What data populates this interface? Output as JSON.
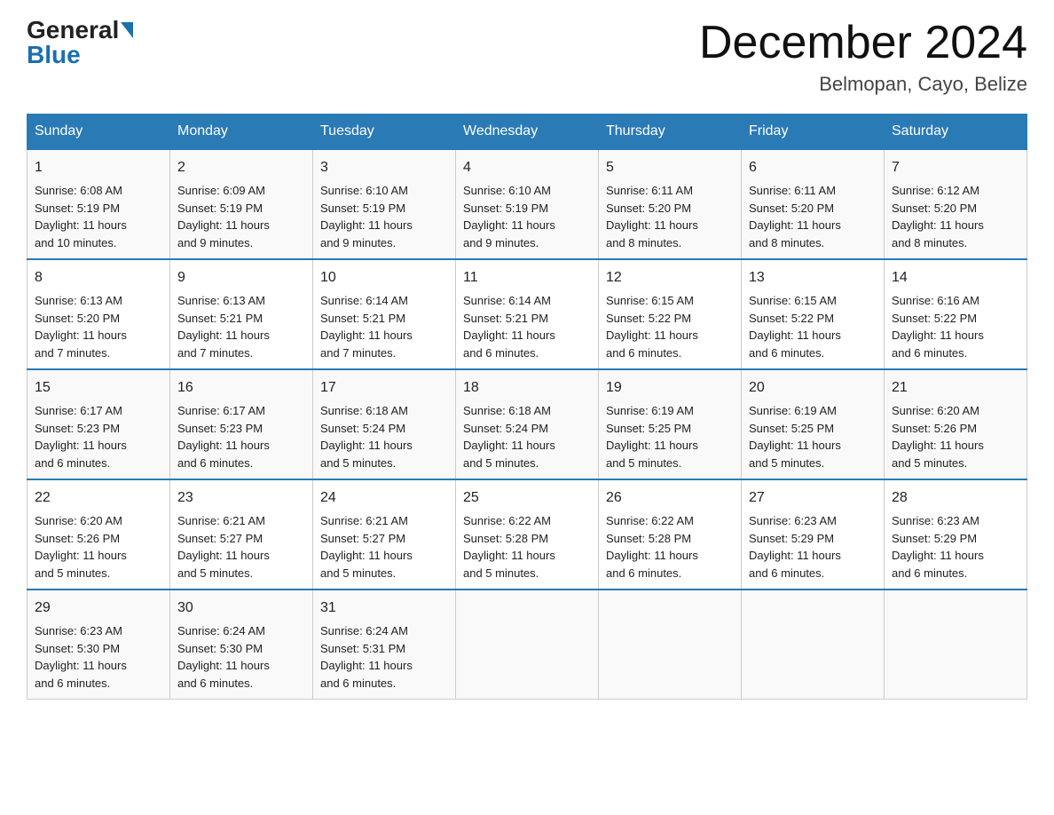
{
  "logo": {
    "general": "General",
    "blue": "Blue"
  },
  "title": "December 2024",
  "subtitle": "Belmopan, Cayo, Belize",
  "weekdays": [
    "Sunday",
    "Monday",
    "Tuesday",
    "Wednesday",
    "Thursday",
    "Friday",
    "Saturday"
  ],
  "weeks": [
    [
      {
        "day": "1",
        "sunrise": "6:08 AM",
        "sunset": "5:19 PM",
        "daylight": "11 hours and 10 minutes."
      },
      {
        "day": "2",
        "sunrise": "6:09 AM",
        "sunset": "5:19 PM",
        "daylight": "11 hours and 9 minutes."
      },
      {
        "day": "3",
        "sunrise": "6:10 AM",
        "sunset": "5:19 PM",
        "daylight": "11 hours and 9 minutes."
      },
      {
        "day": "4",
        "sunrise": "6:10 AM",
        "sunset": "5:19 PM",
        "daylight": "11 hours and 9 minutes."
      },
      {
        "day": "5",
        "sunrise": "6:11 AM",
        "sunset": "5:20 PM",
        "daylight": "11 hours and 8 minutes."
      },
      {
        "day": "6",
        "sunrise": "6:11 AM",
        "sunset": "5:20 PM",
        "daylight": "11 hours and 8 minutes."
      },
      {
        "day": "7",
        "sunrise": "6:12 AM",
        "sunset": "5:20 PM",
        "daylight": "11 hours and 8 minutes."
      }
    ],
    [
      {
        "day": "8",
        "sunrise": "6:13 AM",
        "sunset": "5:20 PM",
        "daylight": "11 hours and 7 minutes."
      },
      {
        "day": "9",
        "sunrise": "6:13 AM",
        "sunset": "5:21 PM",
        "daylight": "11 hours and 7 minutes."
      },
      {
        "day": "10",
        "sunrise": "6:14 AM",
        "sunset": "5:21 PM",
        "daylight": "11 hours and 7 minutes."
      },
      {
        "day": "11",
        "sunrise": "6:14 AM",
        "sunset": "5:21 PM",
        "daylight": "11 hours and 6 minutes."
      },
      {
        "day": "12",
        "sunrise": "6:15 AM",
        "sunset": "5:22 PM",
        "daylight": "11 hours and 6 minutes."
      },
      {
        "day": "13",
        "sunrise": "6:15 AM",
        "sunset": "5:22 PM",
        "daylight": "11 hours and 6 minutes."
      },
      {
        "day": "14",
        "sunrise": "6:16 AM",
        "sunset": "5:22 PM",
        "daylight": "11 hours and 6 minutes."
      }
    ],
    [
      {
        "day": "15",
        "sunrise": "6:17 AM",
        "sunset": "5:23 PM",
        "daylight": "11 hours and 6 minutes."
      },
      {
        "day": "16",
        "sunrise": "6:17 AM",
        "sunset": "5:23 PM",
        "daylight": "11 hours and 6 minutes."
      },
      {
        "day": "17",
        "sunrise": "6:18 AM",
        "sunset": "5:24 PM",
        "daylight": "11 hours and 5 minutes."
      },
      {
        "day": "18",
        "sunrise": "6:18 AM",
        "sunset": "5:24 PM",
        "daylight": "11 hours and 5 minutes."
      },
      {
        "day": "19",
        "sunrise": "6:19 AM",
        "sunset": "5:25 PM",
        "daylight": "11 hours and 5 minutes."
      },
      {
        "day": "20",
        "sunrise": "6:19 AM",
        "sunset": "5:25 PM",
        "daylight": "11 hours and 5 minutes."
      },
      {
        "day": "21",
        "sunrise": "6:20 AM",
        "sunset": "5:26 PM",
        "daylight": "11 hours and 5 minutes."
      }
    ],
    [
      {
        "day": "22",
        "sunrise": "6:20 AM",
        "sunset": "5:26 PM",
        "daylight": "11 hours and 5 minutes."
      },
      {
        "day": "23",
        "sunrise": "6:21 AM",
        "sunset": "5:27 PM",
        "daylight": "11 hours and 5 minutes."
      },
      {
        "day": "24",
        "sunrise": "6:21 AM",
        "sunset": "5:27 PM",
        "daylight": "11 hours and 5 minutes."
      },
      {
        "day": "25",
        "sunrise": "6:22 AM",
        "sunset": "5:28 PM",
        "daylight": "11 hours and 5 minutes."
      },
      {
        "day": "26",
        "sunrise": "6:22 AM",
        "sunset": "5:28 PM",
        "daylight": "11 hours and 6 minutes."
      },
      {
        "day": "27",
        "sunrise": "6:23 AM",
        "sunset": "5:29 PM",
        "daylight": "11 hours and 6 minutes."
      },
      {
        "day": "28",
        "sunrise": "6:23 AM",
        "sunset": "5:29 PM",
        "daylight": "11 hours and 6 minutes."
      }
    ],
    [
      {
        "day": "29",
        "sunrise": "6:23 AM",
        "sunset": "5:30 PM",
        "daylight": "11 hours and 6 minutes."
      },
      {
        "day": "30",
        "sunrise": "6:24 AM",
        "sunset": "5:30 PM",
        "daylight": "11 hours and 6 minutes."
      },
      {
        "day": "31",
        "sunrise": "6:24 AM",
        "sunset": "5:31 PM",
        "daylight": "11 hours and 6 minutes."
      },
      null,
      null,
      null,
      null
    ]
  ],
  "labels": {
    "sunrise": "Sunrise:",
    "sunset": "Sunset:",
    "daylight": "Daylight:"
  }
}
